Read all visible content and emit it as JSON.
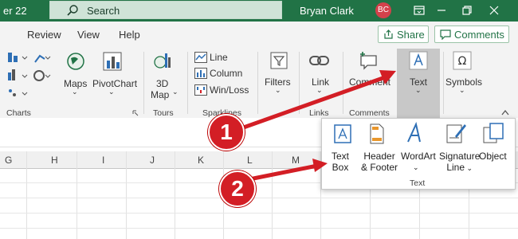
{
  "titlebar": {
    "doc_fragment": "er 22",
    "search_placeholder": "Search",
    "user_name": "Bryan Clark",
    "avatar_initials": "BC"
  },
  "tabs": [
    "Review",
    "View",
    "Help"
  ],
  "top_buttons": {
    "share": "Share",
    "comments": "Comments"
  },
  "ribbon": {
    "maps": "Maps",
    "pivotchart": "PivotChart",
    "map3d": [
      "3D",
      "Map"
    ],
    "sparklines": [
      "Line",
      "Column",
      "Win/Loss"
    ],
    "filters": "Filters",
    "link": "Link",
    "comment": "Comment",
    "text": "Text",
    "symbols": "Symbols",
    "groups": {
      "charts": "Charts",
      "tours": "Tours",
      "sparklines": "Sparklines",
      "links": "Links",
      "comments": "Comments"
    }
  },
  "text_dropdown": {
    "items": [
      {
        "line1": "Text",
        "line2": "Box"
      },
      {
        "line1": "Header",
        "line2": "& Footer"
      },
      {
        "line1": "WordArt",
        "line2": ""
      },
      {
        "line1": "Signature",
        "line2": "Line"
      },
      {
        "line1": "Object",
        "line2": ""
      }
    ],
    "group_label": "Text"
  },
  "columns": [
    "G",
    "H",
    "I",
    "J",
    "K",
    "L",
    "M"
  ],
  "annotations": {
    "step1": "1",
    "step2": "2"
  },
  "colors": {
    "title_bar": "#217346",
    "annotation_red": "#d31e25",
    "avatar": "#d3414b"
  }
}
